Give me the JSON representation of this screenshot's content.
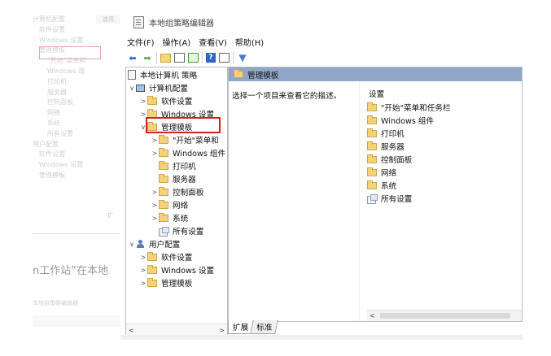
{
  "background": {
    "ghost_tree_items": [
      "计算机配置",
      "软件设置",
      "Windows 设置",
      "管理模板",
      "\"开始\"菜单和",
      "Windows 组",
      "打印机",
      "服务器",
      "控制面板",
      "网络",
      "系统",
      "所有设置",
      "用户配置",
      "软件设置",
      "Windows 设置",
      "管理模板"
    ],
    "ghost_pane_label": "选项",
    "ghost_article_text": "n工作站”在本地",
    "ghost_window_title": "本地组策略编辑器",
    "ghost_scroll_label": "扩"
  },
  "window": {
    "title": "本地组策略编辑器",
    "menu": [
      "文件(F)",
      "操作(A)",
      "查看(V)",
      "帮助(H)"
    ],
    "toolbar_icons": [
      "back-arrow-icon",
      "forward-arrow-icon",
      "up-folder-icon",
      "show-hide-tree-icon",
      "export-list-icon",
      "help-icon",
      "view-icon",
      "filter-icon"
    ]
  },
  "tree": {
    "root": "本地计算机 策略",
    "computer_config": "计算机配置",
    "software_settings": "软件设置",
    "windows_settings": "Windows 设置",
    "admin_templates": "管理模板",
    "start_menu": "\"开始\"菜单和",
    "windows_components": "Windows 组件",
    "printers": "打印机",
    "servers": "服务器",
    "control_panel": "控制面板",
    "network": "网络",
    "system": "系统",
    "all_settings": "所有设置",
    "user_config": "用户配置",
    "user_software_settings": "软件设置",
    "user_windows_settings": "Windows 设置",
    "user_admin_templates": "管理模板",
    "scroll_left": "<",
    "scroll_right": ">"
  },
  "details": {
    "header": "管理模板",
    "description": "选择一个项目来查看它的描述。",
    "column_header": "设置",
    "items": [
      "\"开始\"菜单和任务栏",
      "Windows 组件",
      "打印机",
      "服务器",
      "控制面板",
      "网络",
      "系统",
      "所有设置"
    ],
    "scroll_left": "<"
  },
  "tabs": [
    "扩展",
    "标准"
  ],
  "colors": {
    "header_bar": "#8fa6c7",
    "highlight_box": "#d21f1f",
    "folder": "#f4d27a"
  }
}
